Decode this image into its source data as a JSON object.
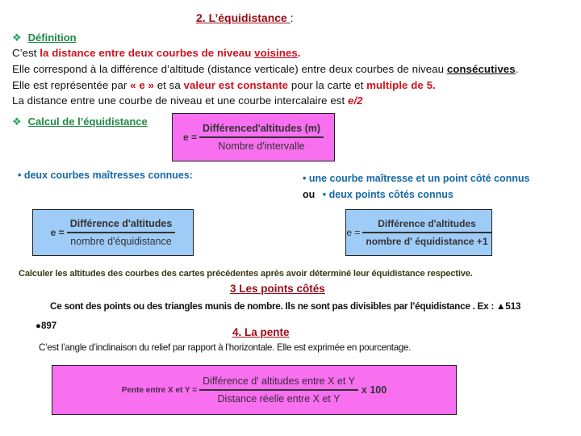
{
  "section2": {
    "title": "2. L’équidistance ",
    "title_colon": ":"
  },
  "definition": {
    "heading": "Définition",
    "line1_pre": "C’est ",
    "line1_red": "la distance entre deux courbes de niveau ",
    "line1_red_ul": "voisines",
    "line1_end": ".",
    "line2_pre": "Elle correspond à la différence d’altitude (distance verticale) entre deux courbes de niveau ",
    "line2_ul": "consécutives",
    "line2_end": ".",
    "line3_pre": " Elle est représentée par ",
    "line3_red1": "« e »",
    "line3_mid": " et sa ",
    "line3_red2": "valeur est constante",
    "line3_mid2": " pour la carte et  ",
    "line3_red3": "multiple de 5.",
    "line4_pre": "La distance entre une courbe de niveau et une courbe intercalaire est ",
    "line4_red": "e/2"
  },
  "calcul": {
    "heading": "Calcul de l’équidistance",
    "formula_main": {
      "label": "e =",
      "numerator": "Différenced'altitudes (m)",
      "denominator": "Nombre d'intervalle",
      "color": "#f86ff0"
    },
    "case1": {
      "label": "• deux courbes maîtresses connues:",
      "formula": {
        "label": "e =",
        "numerator": "Différence d'altitudes",
        "denominator": "nombre d'équidistance",
        "color": "#9fcbf7"
      }
    },
    "case2": {
      "label_line1": "• une courbe maîtresse et un point côté connus",
      "label_ou": "ou",
      "label_line2": "• deux points côtés connus",
      "formula": {
        "label": "e =",
        "numerator": "Différence d'altitudes",
        "denominator": "nombre d' équidistance +1",
        "color": "#9fcbf7"
      }
    },
    "exercise": "Calculer les altitudes des courbes des cartes précédentes après avoir déterminé leur équidistance respective."
  },
  "section3": {
    "title": "3 Les points côtés",
    "text": "Ce sont des points ou des triangles munis de nombre. Ils ne sont pas divisibles par l’équidistance . Ex : ▲513",
    "example2": "●897"
  },
  "section4": {
    "title": "4. La pente",
    "text": "C’est l’angle d’inclinaison du relief par rapport à l’horizontale. Elle est exprimée en pourcentage.",
    "formula": {
      "label": "Pente entre X et Y =",
      "numerator": "Différence d' altitudes entre X et Y",
      "denominator": "Distance réelle entre X et Y",
      "multiplier": "x 100",
      "color": "#f86ff0"
    }
  },
  "icons": {
    "diamond": "❖"
  }
}
